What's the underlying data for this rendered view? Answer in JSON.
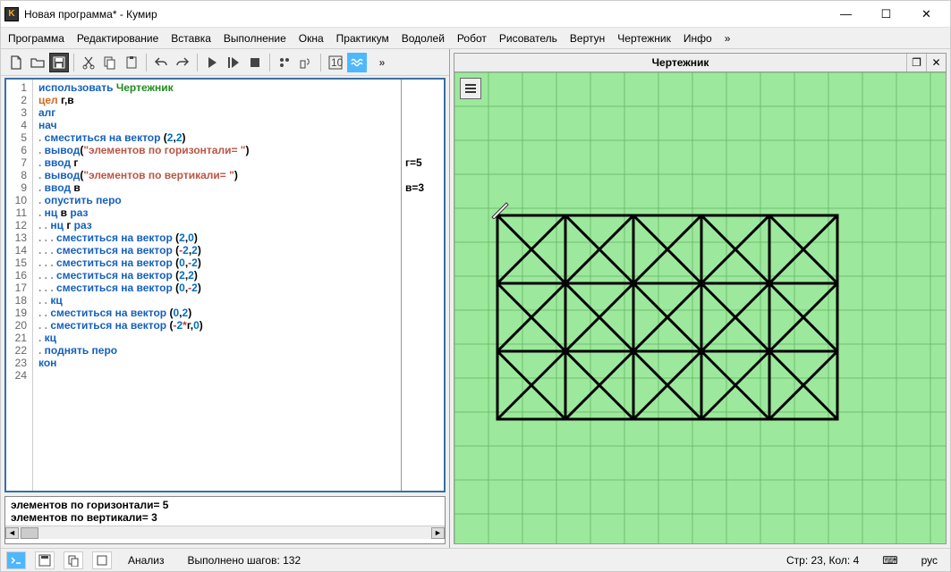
{
  "window": {
    "title": "Новая программа* - Кумир"
  },
  "menu": [
    "Программа",
    "Редактирование",
    "Вставка",
    "Выполнение",
    "Окна",
    "Практикум",
    "Водолей",
    "Робот",
    "Рисователь",
    "Вертун",
    "Чертежник",
    "Инфо",
    "»"
  ],
  "toolbar_overflow": "»",
  "editor": {
    "lines": [
      {
        "n": 1,
        "tokens": [
          [
            "kw",
            "использовать "
          ],
          [
            "mod",
            "Чертежник"
          ]
        ]
      },
      {
        "n": 2,
        "tokens": [
          [
            "type",
            "цел "
          ],
          [
            "id",
            "г,в"
          ]
        ]
      },
      {
        "n": 3,
        "tokens": [
          [
            "kw",
            "алг"
          ]
        ]
      },
      {
        "n": 4,
        "tokens": [
          [
            "kw",
            "нач"
          ]
        ]
      },
      {
        "n": 5,
        "tokens": [
          [
            "dot",
            ". "
          ],
          [
            "kw",
            "сместиться на вектор "
          ],
          [
            "id",
            "("
          ],
          [
            "num",
            "2"
          ],
          [
            "id",
            ","
          ],
          [
            "num",
            "2"
          ],
          [
            "id",
            ")"
          ]
        ]
      },
      {
        "n": 6,
        "tokens": [
          [
            "dot",
            ". "
          ],
          [
            "kw",
            "вывод"
          ],
          [
            "id",
            "("
          ],
          [
            "str",
            "\"элементов по горизонтали= \""
          ],
          [
            "id",
            ")"
          ]
        ]
      },
      {
        "n": 7,
        "tokens": [
          [
            "dot",
            ". "
          ],
          [
            "kw",
            "ввод "
          ],
          [
            "id",
            "г"
          ]
        ],
        "margin": "г=5"
      },
      {
        "n": 8,
        "tokens": [
          [
            "dot",
            ". "
          ],
          [
            "kw",
            "вывод"
          ],
          [
            "id",
            "("
          ],
          [
            "str",
            "\"элементов по вертикали= \""
          ],
          [
            "id",
            ")"
          ]
        ]
      },
      {
        "n": 9,
        "tokens": [
          [
            "dot",
            ". "
          ],
          [
            "kw",
            "ввод "
          ],
          [
            "id",
            "в"
          ]
        ],
        "margin": "в=3"
      },
      {
        "n": 10,
        "tokens": [
          [
            "dot",
            ". "
          ],
          [
            "kw",
            "опустить перо"
          ]
        ]
      },
      {
        "n": 11,
        "tokens": [
          [
            "dot",
            ". "
          ],
          [
            "kw",
            "нц "
          ],
          [
            "id",
            "в "
          ],
          [
            "kw",
            "раз"
          ]
        ]
      },
      {
        "n": 12,
        "tokens": [
          [
            "dot",
            ". . "
          ],
          [
            "kw",
            "нц "
          ],
          [
            "id",
            "г "
          ],
          [
            "kw",
            "раз"
          ]
        ]
      },
      {
        "n": 13,
        "tokens": [
          [
            "dot",
            ". . . "
          ],
          [
            "kw",
            "сместиться на вектор "
          ],
          [
            "id",
            "("
          ],
          [
            "num",
            "2"
          ],
          [
            "id",
            ","
          ],
          [
            "num",
            "0"
          ],
          [
            "id",
            ")"
          ]
        ]
      },
      {
        "n": 14,
        "tokens": [
          [
            "dot",
            ". . . "
          ],
          [
            "kw",
            "сместиться на вектор "
          ],
          [
            "id",
            "("
          ],
          [
            "op",
            "-"
          ],
          [
            "num",
            "2"
          ],
          [
            "id",
            ","
          ],
          [
            "num",
            "2"
          ],
          [
            "id",
            ")"
          ]
        ]
      },
      {
        "n": 15,
        "tokens": [
          [
            "dot",
            ". . . "
          ],
          [
            "kw",
            "сместиться на вектор "
          ],
          [
            "id",
            "("
          ],
          [
            "num",
            "0"
          ],
          [
            "id",
            ","
          ],
          [
            "op",
            "-"
          ],
          [
            "num",
            "2"
          ],
          [
            "id",
            ")"
          ]
        ]
      },
      {
        "n": 16,
        "tokens": [
          [
            "dot",
            ". . . "
          ],
          [
            "kw",
            "сместиться на вектор "
          ],
          [
            "id",
            "("
          ],
          [
            "num",
            "2"
          ],
          [
            "id",
            ","
          ],
          [
            "num",
            "2"
          ],
          [
            "id",
            ")"
          ]
        ]
      },
      {
        "n": 17,
        "tokens": [
          [
            "dot",
            ". . . "
          ],
          [
            "kw",
            "сместиться на вектор "
          ],
          [
            "id",
            "("
          ],
          [
            "num",
            "0"
          ],
          [
            "id",
            ","
          ],
          [
            "op",
            "-"
          ],
          [
            "num",
            "2"
          ],
          [
            "id",
            ")"
          ]
        ]
      },
      {
        "n": 18,
        "tokens": [
          [
            "dot",
            ". . "
          ],
          [
            "kw",
            "кц"
          ]
        ]
      },
      {
        "n": 19,
        "tokens": [
          [
            "dot",
            ". . "
          ],
          [
            "kw",
            "сместиться на вектор "
          ],
          [
            "id",
            "("
          ],
          [
            "num",
            "0"
          ],
          [
            "id",
            ","
          ],
          [
            "num",
            "2"
          ],
          [
            "id",
            ")"
          ]
        ]
      },
      {
        "n": 20,
        "tokens": [
          [
            "dot",
            ". . "
          ],
          [
            "kw",
            "сместиться на вектор "
          ],
          [
            "id",
            "("
          ],
          [
            "op",
            "-"
          ],
          [
            "num",
            "2"
          ],
          [
            "op",
            "*"
          ],
          [
            "id",
            "г,"
          ],
          [
            "num",
            "0"
          ],
          [
            "id",
            ")"
          ]
        ]
      },
      {
        "n": 21,
        "tokens": [
          [
            "dot",
            ". "
          ],
          [
            "kw",
            "кц"
          ]
        ]
      },
      {
        "n": 22,
        "tokens": [
          [
            "dot",
            ". "
          ],
          [
            "kw",
            "поднять перо"
          ]
        ]
      },
      {
        "n": 23,
        "tokens": [
          [
            "kw",
            "кон"
          ]
        ]
      },
      {
        "n": 24,
        "tokens": [
          [
            "id",
            ""
          ]
        ]
      }
    ]
  },
  "output": {
    "lines": [
      "элементов по горизонтали= 5",
      "элементов по вертикали= 3"
    ]
  },
  "canvas": {
    "title": "Чертежник"
  },
  "status": {
    "analysis": "Анализ",
    "steps": "Выполнено шагов: 132",
    "pos": "Стр: 23, Кол: 4",
    "lang": "рус",
    "kbd_icon": "⌨"
  }
}
